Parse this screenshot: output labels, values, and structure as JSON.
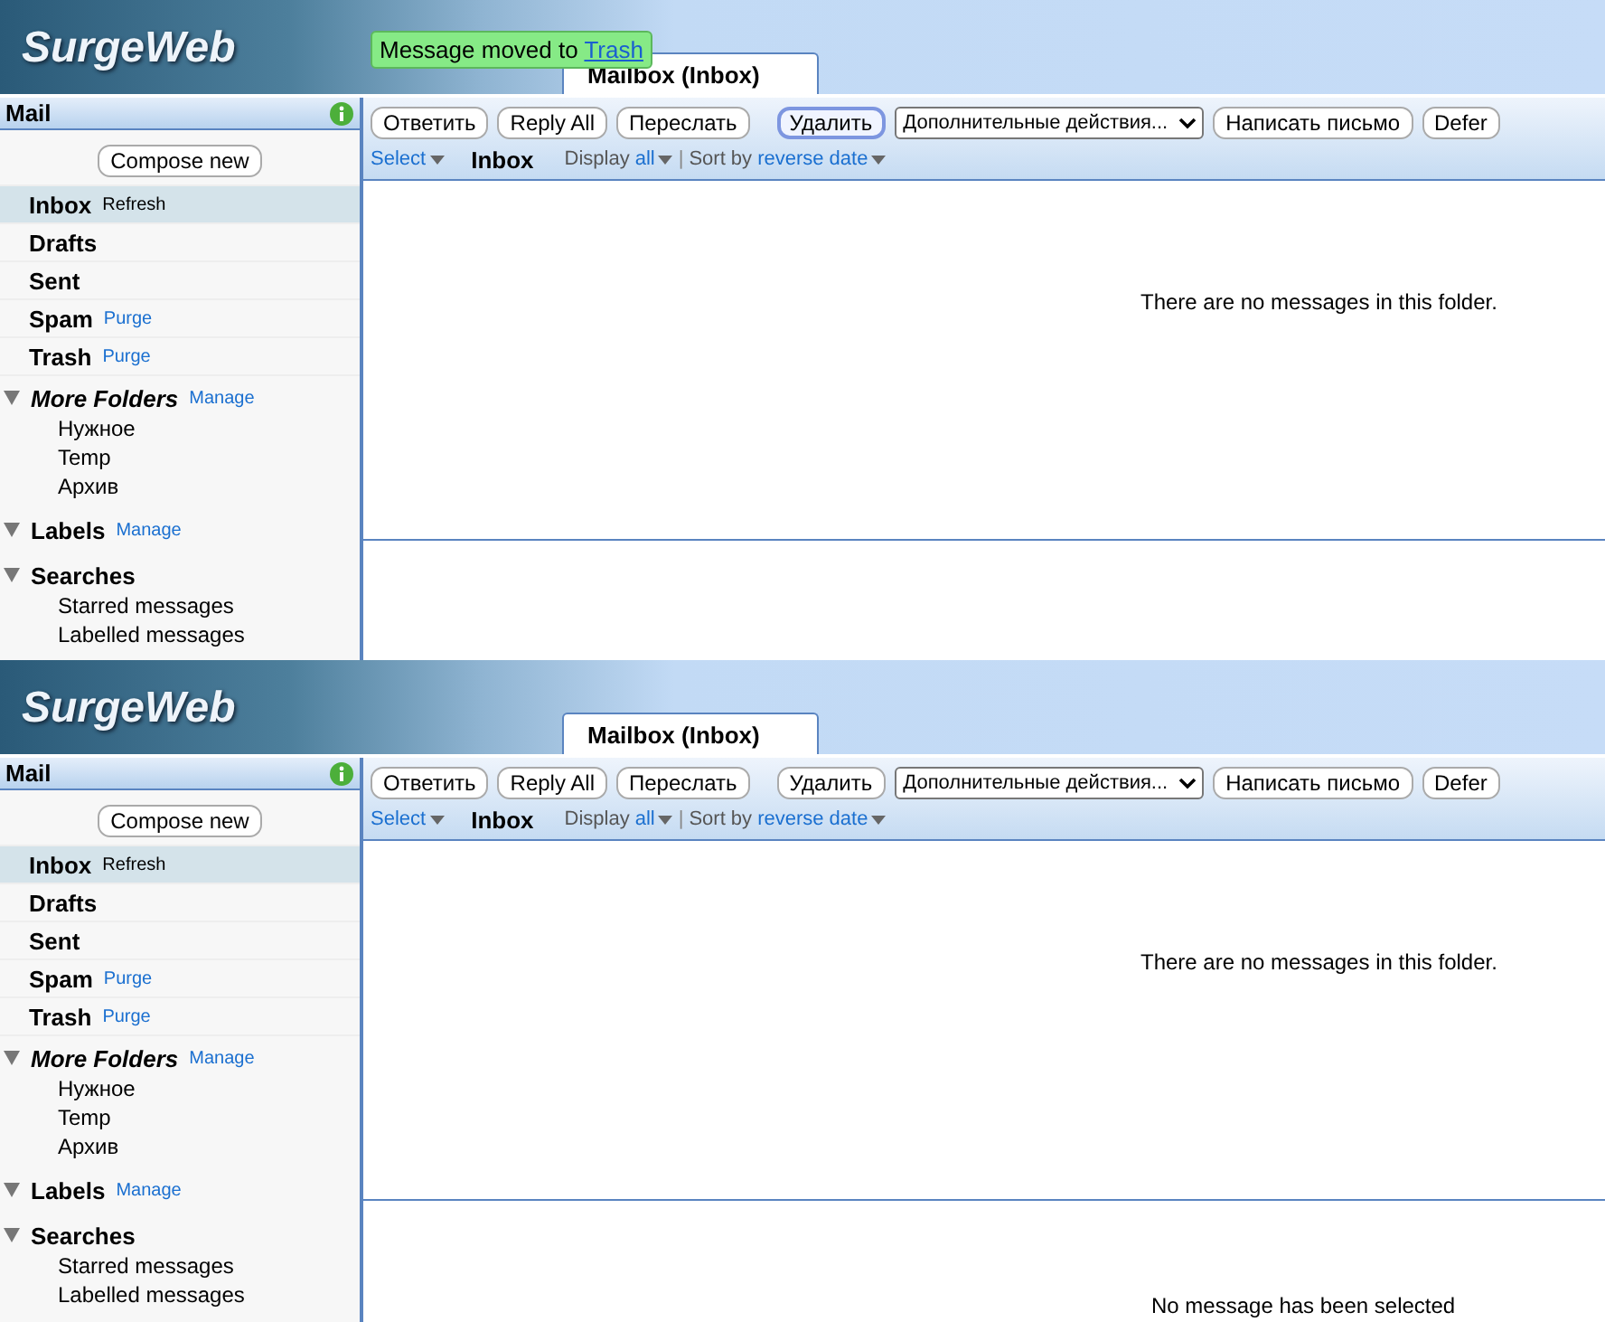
{
  "panels": [
    {
      "logo": "SurgeWeb",
      "toast": {
        "text": "Message moved to ",
        "link": "Trash"
      },
      "tab": {
        "label": "Mailbox (Inbox)",
        "selected": true
      },
      "sidebar": {
        "title": "Mail",
        "compose": "Compose new",
        "folders": [
          {
            "name": "Inbox",
            "action": "Refresh",
            "selected": true
          },
          {
            "name": "Drafts",
            "selected": false
          },
          {
            "name": "Sent",
            "selected": false
          },
          {
            "name": "Spam",
            "action": "Purge",
            "selected": false
          },
          {
            "name": "Trash",
            "action": "Purge",
            "selected": false
          }
        ],
        "sections": [
          {
            "title": "More Folders",
            "italic": true,
            "action": "Manage",
            "expanded": true,
            "children": [
              "Нужное",
              "Temp",
              "Архив"
            ]
          },
          {
            "title": "Labels",
            "italic": false,
            "action": "Manage",
            "expanded": true
          },
          {
            "title": "Searches",
            "italic": false,
            "expanded": true,
            "children": [
              "Starred messages",
              "Labelled messages"
            ]
          }
        ]
      },
      "toolbar": [
        {
          "kind": "button",
          "label": "Ответить",
          "focused": false
        },
        {
          "kind": "button",
          "label": "Reply All",
          "focused": false
        },
        {
          "kind": "button",
          "label": "Переслать",
          "focused": false
        },
        {
          "kind": "button",
          "label": "Удалить",
          "focused": true
        },
        {
          "kind": "select",
          "label": "Дополнительные действия...",
          "focused": false
        },
        {
          "kind": "button",
          "label": "Написать письмо",
          "focused": false
        },
        {
          "kind": "button",
          "label": "Defer",
          "focused": false
        }
      ],
      "view": {
        "select": "Select",
        "folder": "Inbox",
        "display": "Display",
        "display_value": "all",
        "separator": "|",
        "sort": "Sort by",
        "sort_value": "reverse date"
      },
      "list_message": "There are no messages in this folder."
    },
    {
      "logo": "SurgeWeb",
      "tab": {
        "label": "Mailbox (Inbox)",
        "selected": true
      },
      "sidebar": {
        "title": "Mail",
        "compose": "Compose new",
        "folders": [
          {
            "name": "Inbox",
            "action": "Refresh",
            "selected": true
          },
          {
            "name": "Drafts",
            "selected": false
          },
          {
            "name": "Sent",
            "selected": false
          },
          {
            "name": "Spam",
            "action": "Purge",
            "selected": false
          },
          {
            "name": "Trash",
            "action": "Purge",
            "selected": false
          }
        ],
        "sections": [
          {
            "title": "More Folders",
            "italic": true,
            "action": "Manage",
            "expanded": true,
            "children": [
              "Нужное",
              "Temp",
              "Архив"
            ]
          },
          {
            "title": "Labels",
            "italic": false,
            "action": "Manage",
            "expanded": true
          },
          {
            "title": "Searches",
            "italic": false,
            "expanded": true,
            "children": [
              "Starred messages",
              "Labelled messages"
            ]
          }
        ]
      },
      "toolbar": [
        {
          "kind": "button",
          "label": "Ответить",
          "focused": false
        },
        {
          "kind": "button",
          "label": "Reply All",
          "focused": false
        },
        {
          "kind": "button",
          "label": "Переслать",
          "focused": false
        },
        {
          "kind": "button",
          "label": "Удалить",
          "focused": false
        },
        {
          "kind": "select",
          "label": "Дополнительные действия...",
          "focused": false
        },
        {
          "kind": "button",
          "label": "Написать письмо",
          "focused": false
        },
        {
          "kind": "button",
          "label": "Defer",
          "focused": false
        }
      ],
      "view": {
        "select": "Select",
        "folder": "Inbox",
        "display": "Display",
        "display_value": "all",
        "separator": "|",
        "sort": "Sort by",
        "sort_value": "reverse date"
      },
      "list_message": "There are no messages in this folder.",
      "preview_message": "No message has been selected"
    }
  ]
}
